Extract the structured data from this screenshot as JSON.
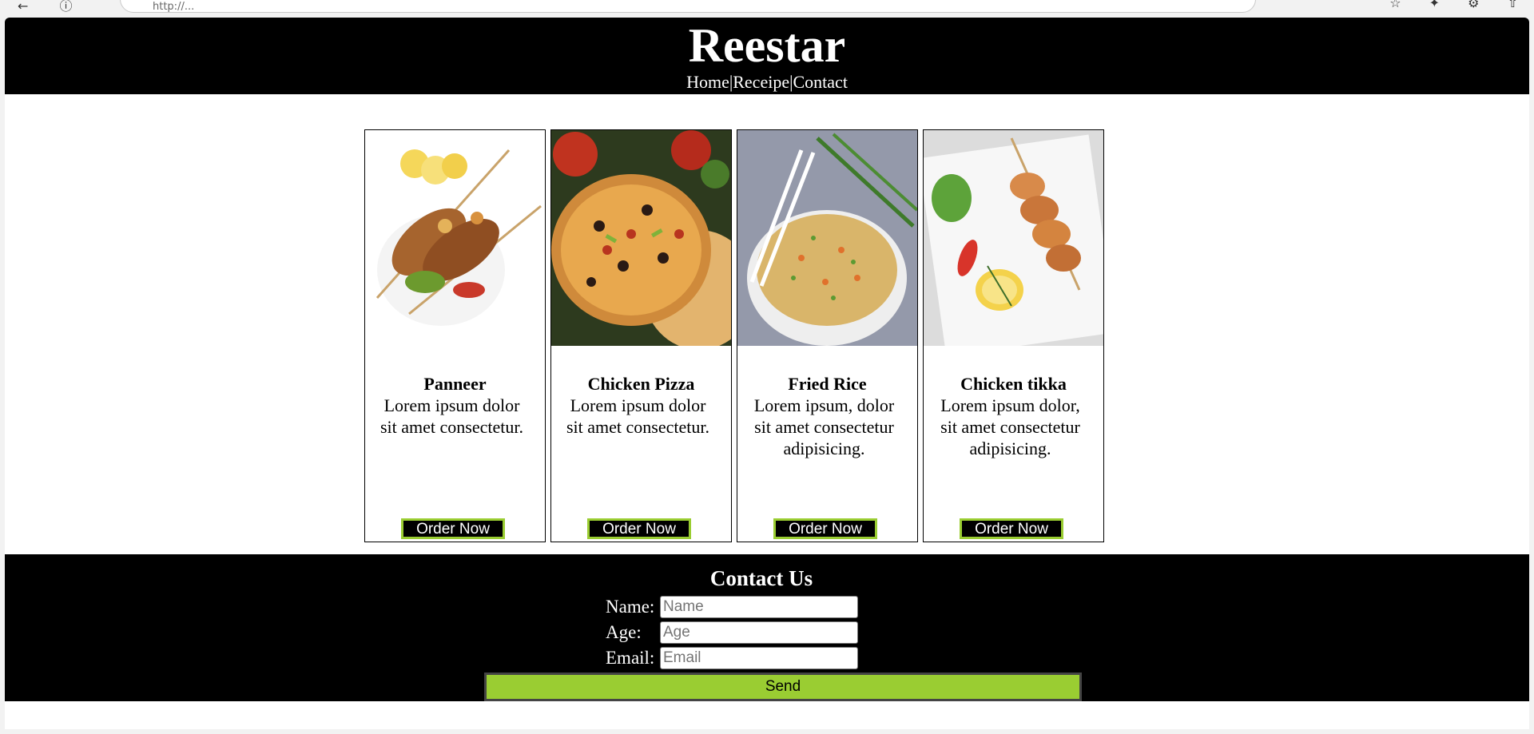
{
  "browser": {
    "back_icon": "arrow-left-icon",
    "info_icon": "info-icon",
    "url_text": "http://...",
    "tools": [
      "bookmark-icon",
      "extension-icon",
      "settings-icon",
      "share-icon"
    ]
  },
  "site": {
    "title": "Reestar",
    "nav": [
      "Home",
      "|",
      "Receipe",
      "|",
      "Contact"
    ]
  },
  "cards": [
    {
      "name": "Panneer",
      "desc": "Lorem ipsum dolor sit amet consectetur.",
      "button": "Order Now",
      "image": "paneer-skewers"
    },
    {
      "name": "Chicken Pizza",
      "desc": "Lorem ipsum dolor sit amet consectetur.",
      "button": "Order Now",
      "image": "pizza"
    },
    {
      "name": "Fried Rice",
      "desc": "Lorem ipsum, dolor sit amet consectetur adipisicing.",
      "button": "Order Now",
      "image": "fried-rice"
    },
    {
      "name": "Chicken tikka",
      "desc": "Lorem ipsum dolor, sit amet consectetur adipisicing.",
      "button": "Order Now",
      "image": "chicken-tikka"
    }
  ],
  "contact": {
    "title": "Contact Us",
    "name_label": "Name:",
    "name_placeholder": "Name",
    "age_label": "Age:",
    "age_placeholder": "Age",
    "email_label": "Email:",
    "email_placeholder": "Email",
    "send_label": "Send"
  },
  "colors": {
    "header": "#000000",
    "accent": "#9acd32",
    "footer": "#000000"
  }
}
